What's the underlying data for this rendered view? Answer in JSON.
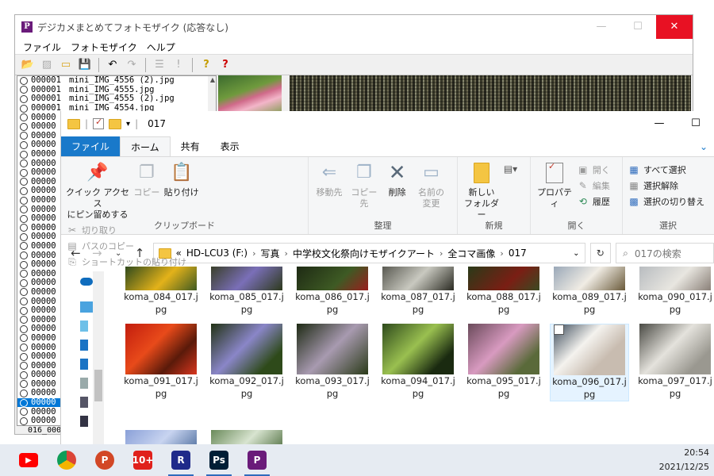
{
  "mosaic": {
    "title": "デジカメまとめてフォトモザイク (応答なし)",
    "menu": [
      "ファイル",
      "フォトモザイク",
      "ヘルプ"
    ],
    "list_top": [
      {
        "num": "000001",
        "file": "mini_IMG_4556 (2).jpg"
      },
      {
        "num": "000001",
        "file": "mini_IMG_4555.jpg"
      },
      {
        "num": "000001",
        "file": "mini_IMG_4555 (2).jpg"
      },
      {
        "num": "000001",
        "file": "mini_IMG_4554.jpg"
      }
    ],
    "list_partial_num": "00000",
    "status": "016_000"
  },
  "explorer": {
    "title": "017",
    "tabs": [
      "ファイル",
      "ホーム",
      "共有",
      "表示"
    ],
    "ribbon": {
      "clipboard": {
        "label": "クリップボード",
        "pin": "クイック アクセス\nにピン留めする",
        "copy": "コピー",
        "paste": "貼り付け",
        "cut": "切り取り",
        "copy_path": "パスのコピー",
        "paste_shortcut": "ショートカットの貼り付け"
      },
      "organize": {
        "label": "整理",
        "move_to": "移動先",
        "copy_to": "コピー先",
        "delete": "削除",
        "rename": "名前の\n変更"
      },
      "new": {
        "label": "新規",
        "new_folder": "新しい\nフォルダー"
      },
      "open": {
        "label": "開く",
        "properties": "プロパティ",
        "open": "開く",
        "edit": "編集",
        "history": "履歴"
      },
      "select": {
        "label": "選択",
        "select_all": "すべて選択",
        "select_none": "選択解除",
        "invert": "選択の切り替え"
      }
    },
    "address": {
      "parts": [
        "«",
        "HD-LCU3 (F:)",
        "写真",
        "中学校文化祭向けモザイクアート",
        "全コマ画像",
        "017"
      ],
      "search_placeholder": "017の検索"
    },
    "files_row1": [
      "koma_084_017.jpg",
      "koma_085_017.jpg",
      "koma_086_017.jpg",
      "koma_087_017.jpg",
      "koma_088_017.jpg",
      "koma_089_017.jpg",
      "koma_090_017.jpg"
    ],
    "files_row2": [
      "koma_091_017.jpg",
      "koma_092_017.jpg",
      "koma_093_017.jpg",
      "koma_094_017.jpg",
      "koma_095_017.jpg",
      "koma_096_017.jpg",
      "koma_097_017.jpg"
    ],
    "selected_file": "koma_096_017.jpg"
  },
  "taskbar": {
    "apps": [
      {
        "icon": "youtube-icon",
        "label": "",
        "color": "#ff0000"
      },
      {
        "icon": "chrome-icon",
        "label": "",
        "color": "#4285f4"
      },
      {
        "icon": "powerpoint-icon",
        "label": "P",
        "color": "#d24726"
      },
      {
        "icon": "app-10plus-icon",
        "label": "10+",
        "color": "#e0201b"
      },
      {
        "icon": "app-r-icon",
        "label": "R",
        "color": "#1f2a8a"
      },
      {
        "icon": "photoshop-icon",
        "label": "Ps",
        "color": "#001e36"
      },
      {
        "icon": "app-p-icon",
        "label": "P",
        "color": "#6a1b7a"
      }
    ],
    "time": "20:54",
    "date": "2021/12/25"
  }
}
